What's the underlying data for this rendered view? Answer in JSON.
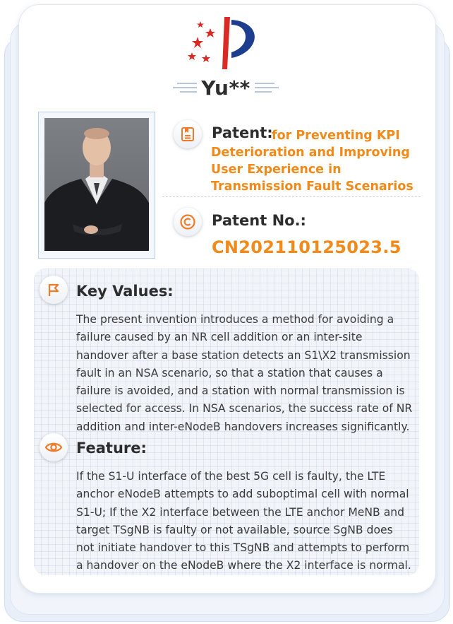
{
  "brand": {
    "name": "Yu**"
  },
  "patent": {
    "label": "Patent:",
    "title": "for Preventing KPI Deterioration and Improving User Experience in Transmission Fault Scenarios",
    "number_label": "Patent No.:",
    "number": "CN202110125023.5"
  },
  "key_values": {
    "title": "Key Values:",
    "text": "The present invention introduces a method for avoiding a failure caused by an NR cell addition or an inter-site handover after a base station detects an S1\\X2 transmission fault in an NSA scenario, so that a station that causes a failure is avoided, and a station with normal transmission is selected for access. In NSA scenarios, the success rate of NR addition and inter-eNodeB handovers increases significantly."
  },
  "feature": {
    "title": "Feature:",
    "text": "If the S1-U interface of the best 5G cell is faulty, the LTE anchor eNodeB attempts to add suboptimal cell with normal S1-U; If the X2 interface between the LTE anchor MeNB and target TSgNB is faulty or not available, source SgNB does not initiate handover to this TSgNB and attempts to perform a handover on the eNodeB where the X2 interface is normal."
  },
  "icons": {
    "logo": "stars-p-logo",
    "patent": "document-icon",
    "patent_number": "copyright-icon",
    "key_values": "flag-icon",
    "feature": "eye-icon"
  },
  "colors": {
    "accent": "#f28a1a",
    "logo_red": "#d92a25",
    "logo_blue": "#1d3d8f"
  }
}
